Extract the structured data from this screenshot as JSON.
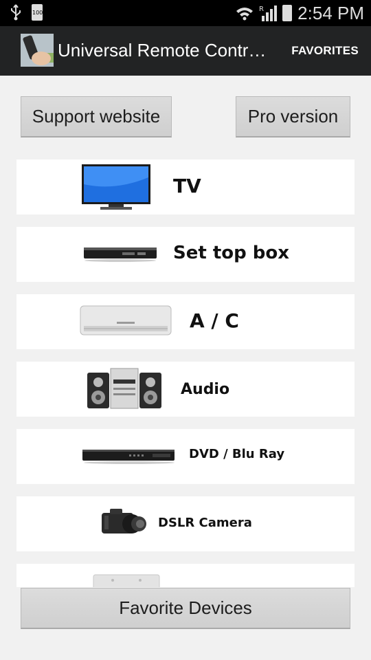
{
  "status_bar": {
    "battery_level": "100",
    "roaming_indicator": "R",
    "time": "2:54 PM",
    "icons": [
      "usb-icon",
      "battery-icon",
      "wifi-icon",
      "signal-icon",
      "battery-full-icon"
    ]
  },
  "action_bar": {
    "title": "Universal Remote Contr…",
    "favorites_label": "FAVORITES"
  },
  "buttons": {
    "support_website": "Support website",
    "pro_version": "Pro version",
    "favorite_devices": "Favorite Devices"
  },
  "devices": [
    {
      "label": "TV",
      "icon": "tv-icon"
    },
    {
      "label": "Set top box",
      "icon": "set-top-box-icon"
    },
    {
      "label": "A / C",
      "icon": "air-conditioner-icon"
    },
    {
      "label": "Audio",
      "icon": "audio-system-icon"
    },
    {
      "label": "DVD / Blu Ray",
      "icon": "dvd-player-icon"
    },
    {
      "label": "DSLR Camera",
      "icon": "camera-icon"
    },
    {
      "label": "",
      "icon": "device-icon"
    }
  ]
}
